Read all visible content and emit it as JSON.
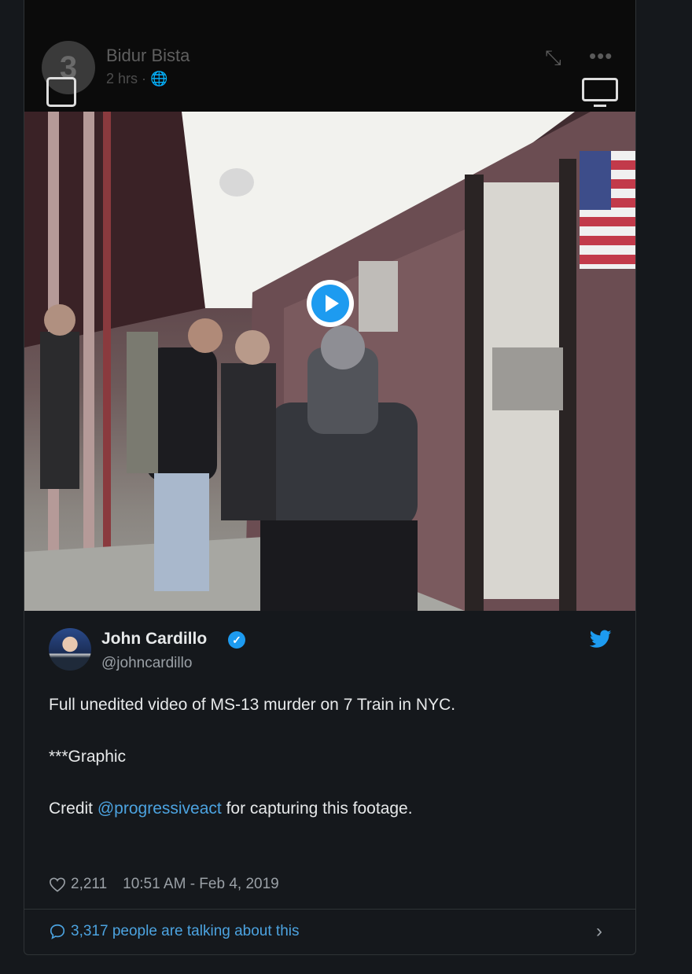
{
  "window": {
    "info_icon": "i"
  },
  "video": {
    "overlay": {
      "author": "Bidur Bista",
      "meta": "2 hrs · 🌐",
      "avatar_glyph": "3",
      "expand_glyph": "⤡",
      "more_glyph": "•••"
    },
    "play_icon": "play-icon"
  },
  "tweet": {
    "display_name": "John Cardillo",
    "handle": "@johncardillo",
    "verified_glyph": "✓",
    "text": {
      "line1": "Full unedited video of MS-13 murder on 7 Train in NYC.",
      "line2": "***Graphic",
      "line3_prefix": "Credit ",
      "line3_mention": "@progressiveact",
      "line3_suffix": " for capturing this footage."
    },
    "likes": "2,211",
    "timestamp": "10:51 AM - Feb 4, 2019",
    "talking": "3,317 people are talking about this"
  },
  "colors": {
    "accent": "#1d9bf0",
    "link": "#4ca3e0",
    "background": "#15181c"
  }
}
